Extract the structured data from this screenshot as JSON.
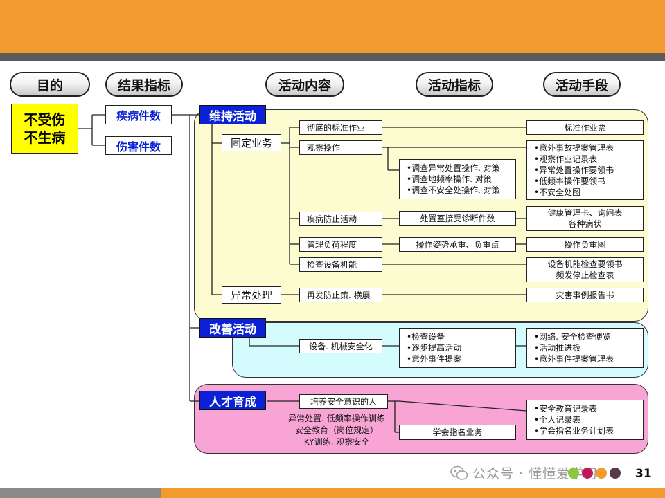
{
  "columns": {
    "purpose": "目的",
    "result": "结果指标",
    "activity": "活动内容",
    "indicator": "活动指标",
    "means": "活动手段"
  },
  "purpose": {
    "line1": "不受伤",
    "line2": "不生病"
  },
  "results": {
    "disease": "疾病件数",
    "injury": "伤害件数"
  },
  "maintain": {
    "title": "维持活动",
    "fixed": "固定业务",
    "abnormal": "异常处理",
    "activities": {
      "standard": "彻底的标准作业",
      "observe": "观察操作",
      "disease_prevent": "疾病防止活动",
      "load": "管理负荷程度",
      "equipment": "检查设备机能",
      "recur": "再发防止策. 横展"
    },
    "indicators": {
      "observe": [
        "•调查异常处置操作. 对策",
        "•调查地频率操作. 对策",
        "•调查不安全处操作. 对策"
      ],
      "disease": "处置室接受诊断件数",
      "load": "操作姿势承重、负重点"
    },
    "means": {
      "standard": "标准作业票",
      "observe": [
        "•意外事故提案管理表",
        "•观察作业记录表",
        "•异常处置操作要领书",
        "•低频率操作要领书",
        "•不安全处图"
      ],
      "health": [
        "健康管理卡、询问表",
        "各种病状"
      ],
      "load": "操作负重图",
      "equipment": [
        "设备机能检查要领书",
        "频发停止检查表"
      ],
      "disaster": "灾害事例报告书"
    }
  },
  "improve": {
    "title": "改善活动",
    "activity": "设备. 机械安全化",
    "indicators": [
      "•检查设备",
      "•逐步提高活动",
      "•意外事件提案"
    ],
    "means": [
      "•网络. 安全检查便览",
      "•活动推进板",
      "•意外事件提案管理表"
    ]
  },
  "talent": {
    "title": "人才育成",
    "activity": "培养安全意识的人",
    "texts": [
      "异常处置. 低频率操作训练",
      "安全教育（岗位规定）",
      "KY训练. 观察安全"
    ],
    "indicator": "学会指名业务",
    "means": [
      "•安全教育记录表",
      "•个人记录表",
      "•学会指名业务计划表"
    ]
  },
  "footer": {
    "watermark": "公众号 · 懂懂爱学习",
    "page_number": "31",
    "dot_colors": [
      "#8dc63f",
      "#c2185b",
      "#f29a2e",
      "#5a3a4a"
    ]
  },
  "colors": {
    "accent_orange": "#f29a2e",
    "header_blue": "#0a21d6",
    "purpose_yellow": "#ffff00",
    "panel_yellow": "#fdfbd0",
    "panel_cyan": "#d4fbfd",
    "panel_pink": "#f8a4d4"
  }
}
